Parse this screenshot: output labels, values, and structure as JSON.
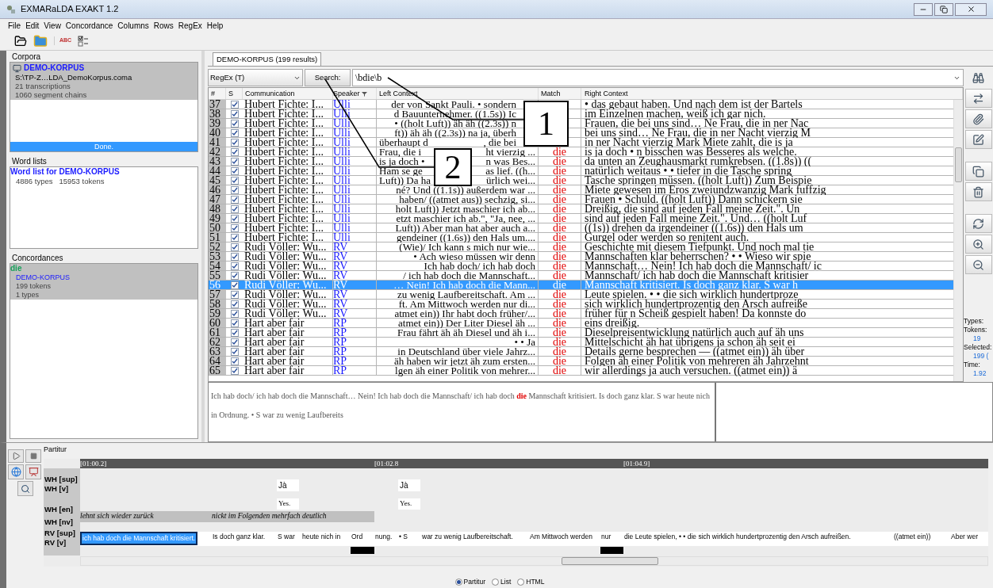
{
  "window": {
    "title": "EXMARaLDA EXAKT 1.2"
  },
  "menu": [
    "File",
    "Edit",
    "View",
    "Concordance",
    "Columns",
    "Rows",
    "RegEx",
    "Help"
  ],
  "toolbar": {
    "spell_label": "ABC"
  },
  "corpora": {
    "title": "Corpora",
    "items": [
      {
        "name": "DEMO-KORPUS",
        "path": "S:\\TP-Z…LDA_DemoKorpus.coma",
        "transcriptions": "21 transcriptions",
        "chains": "1060 segment chains",
        "selected": true
      }
    ],
    "progress": {
      "label": "Done.",
      "level": 1
    }
  },
  "word_lists": {
    "title": "Word lists",
    "items": [
      {
        "name": "Word list for DEMO-KORPUS",
        "types": "4886 types",
        "tokens": "15953 tokens"
      }
    ]
  },
  "concordances": {
    "title": "Concordances",
    "items": [
      {
        "query": "die",
        "corpus": "DEMO-KORPUS",
        "tokens": "199 tokens",
        "types": "1 types",
        "selected": true
      }
    ]
  },
  "tab": {
    "label": "DEMO-KORPUS (199 results)",
    "selected": true
  },
  "search": {
    "mode": "RegEx (T)",
    "button": "Search:",
    "value": "\\bdie\\b"
  },
  "table": {
    "columns": [
      "#",
      "S",
      "Communication",
      "Speaker",
      "Left Context",
      "Match",
      "Right Context"
    ],
    "rows": [
      {
        "n": "37",
        "checked": true,
        "communication": "Hubert Fichte: I...",
        "speaker": "Ulli",
        "left": "der von Sankt Pauli. • sondern",
        "right": "• das gebaut haben. Und nach dem ist der Bartels",
        "selected": false
      },
      {
        "n": "38",
        "checked": true,
        "communication": "Hubert Fichte: I...",
        "speaker": "Ulli",
        "left": "d Bauunternehmer. ((1.5s)) Ic",
        "right": "im Einzelnen machen, weiß ich gar nich.",
        "selected": false
      },
      {
        "n": "39",
        "checked": true,
        "communication": "Hubert Fichte: I...",
        "speaker": "Ulli",
        "left": "• ((holt Luft)) äh äh ((2.3s)) n",
        "right": "Frauen, die bei uns sind… Ne Frau, die in ner Nac",
        "selected": false
      },
      {
        "n": "40",
        "checked": true,
        "communication": "Hubert Fichte: I...",
        "speaker": "Ulli",
        "left": "ft)) äh äh ((2.3s)) na ja, überh",
        "right": "bei uns sind… Ne Frau, die in ner Nacht vierzig M",
        "selected": false
      },
      {
        "n": "41",
        "checked": true,
        "communication": "Hubert Fichte: I...",
        "speaker": "Ulli",
        "left": "überhaupt d",
        "left_tail": ", die bei",
        "right": "in ner Nacht vierzig Mark Miete zahlt, die is ja",
        "selected": false
      },
      {
        "n": "42",
        "checked": true,
        "communication": "Hubert Fichte: I...",
        "speaker": "Ulli",
        "left": "Frau, die i",
        "left_tail": "ht vierzig ...",
        "match": "die",
        "right": "is ja doch • n bisschen was Besseres als welche.",
        "selected": false
      },
      {
        "n": "43",
        "checked": true,
        "communication": "Hubert Fichte: I...",
        "speaker": "Ulli",
        "left": "is ja doch •",
        "left_tail": "n was Bes...",
        "match": "die",
        "right": "da unten an Zeughausmarkt rumkrebsen. ((1.8s)) ((",
        "selected": false
      },
      {
        "n": "44",
        "checked": true,
        "communication": "Hubert Fichte: I...",
        "speaker": "Ulli",
        "left": "Ham se ge",
        "left_tail": "as lief. ((h...",
        "match": "die",
        "right": "natürlich weitaus • • tiefer in die Tasche spring",
        "selected": false
      },
      {
        "n": "45",
        "checked": true,
        "communication": "Hubert Fichte: I...",
        "speaker": "Ulli",
        "left": "Luft)) Da ha",
        "left_tail": "ürlich wei...",
        "match": "die",
        "right": "Tasche springen müssen. ((holt Luft)) Zum Beispie",
        "selected": false
      },
      {
        "n": "46",
        "checked": true,
        "communication": "Hubert Fichte: I...",
        "speaker": "Ulli",
        "left": "né? Und ((1.1s)) außerdem war ...",
        "match": "die",
        "right": "Miete gewesen im Eros zweiundzwanzig Mark fuffzig",
        "selected": false
      },
      {
        "n": "47",
        "checked": true,
        "communication": "Hubert Fichte: I...",
        "speaker": "Ulli",
        "left": "haben/ ((atmet aus)) sechzig, si...",
        "match": "die",
        "right": "Frauen • Schuld. ((holt Luft)) Dann schickern sie",
        "selected": false
      },
      {
        "n": "48",
        "checked": true,
        "communication": "Hubert Fichte: I...",
        "speaker": "Ulli",
        "left": "holt Luft)) Jetzt maschier ich ab...",
        "match": "die",
        "right": "Dreißig, die sind auf jeden Fall meine Zeit.\". Un",
        "selected": false
      },
      {
        "n": "49",
        "checked": true,
        "communication": "Hubert Fichte: I...",
        "speaker": "Ulli",
        "left": "etzt maschier ich ab.\", \"Ja, nee, ...",
        "match": "die",
        "right": "sind auf jeden Fall meine Zeit.\". Und… ((holt Luf",
        "selected": false
      },
      {
        "n": "50",
        "checked": true,
        "communication": "Hubert Fichte: I...",
        "speaker": "Ulli",
        "left": "Luft)) Aber man hat aber auch a...",
        "match": "die",
        "right": "((1s)) drehen da irgendeiner ((1.6s)) den Hals um",
        "selected": false
      },
      {
        "n": "51",
        "checked": true,
        "communication": "Hubert Fichte: I...",
        "speaker": "Ulli",
        "left": "gendeiner ((1.6s)) den Hals um....",
        "match": "die",
        "right": "Gurgel oder werden so renitent auch.",
        "selected": false
      },
      {
        "n": "52",
        "checked": true,
        "communication": "Rudi Völler: Wu...",
        "speaker": "RV",
        "left": "(Wie)/ Ich kann s mich nur wie...",
        "match": "die",
        "right": "Geschichte mit diesem Tiefpunkt. Und noch mal tie",
        "selected": false
      },
      {
        "n": "53",
        "checked": true,
        "communication": "Rudi Völler: Wu...",
        "speaker": "RV",
        "left": "• Ach wieso müssen wir denn",
        "match": "die",
        "right": "Mannschaften klar beherrschen? • • Wieso wir spie",
        "selected": false
      },
      {
        "n": "54",
        "checked": true,
        "communication": "Rudi Völler: Wu...",
        "speaker": "RV",
        "left": "Ich hab doch/ ich hab doch",
        "match": "die",
        "right": "Mannschaft… Nein! Ich hab doch die Mannschaft/ ic",
        "selected": false
      },
      {
        "n": "55",
        "checked": true,
        "communication": "Rudi Völler: Wu...",
        "speaker": "RV",
        "left": "/ ich hab doch die Mannschaft...",
        "match": "die",
        "right": "Mannschaft/ ich hab doch die Mannschaft kritisier",
        "selected": false
      },
      {
        "n": "56",
        "checked": true,
        "communication": "Rudi Völler: Wu...",
        "speaker": "RV",
        "left": "… Nein! Ich hab doch die Mann...",
        "match": "die",
        "right": "Mannschaft kritisiert. Is doch ganz klar. S war h",
        "selected": true
      },
      {
        "n": "57",
        "checked": true,
        "communication": "Rudi Völler: Wu...",
        "speaker": "RV",
        "left": "zu wenig Laufbereitschaft. Am ...",
        "match": "die",
        "right": "Leute spielen. • • die sich wirklich hundertproze",
        "selected": false
      },
      {
        "n": "58",
        "checked": true,
        "communication": "Rudi Völler: Wu...",
        "speaker": "RV",
        "left": "ft. Am Mittwoch werden nur di...",
        "match": "die",
        "right": "sich wirklich hundertprozentig den Arsch aufreiße",
        "selected": false
      },
      {
        "n": "59",
        "checked": true,
        "communication": "Rudi Völler: Wu...",
        "speaker": "RV",
        "left": "atmet ein)) Ihr habt doch früher/...",
        "match": "die",
        "right": "früher für n Scheiß gespielt haben! Da konnste do",
        "selected": false
      },
      {
        "n": "60",
        "checked": true,
        "communication": "Hart aber fair",
        "speaker": "RP",
        "left": "atmet ein)) Der Liter Diesel äh ...",
        "match": "die",
        "right": "eins dreißig.",
        "selected": false
      },
      {
        "n": "61",
        "checked": true,
        "communication": "Hart aber fair",
        "speaker": "RP",
        "left": "Frau fährt äh äh Diesel und äh i...",
        "match": "die",
        "right": "Dieselpreisentwicklung natürlich auch auf äh uns",
        "selected": false
      },
      {
        "n": "62",
        "checked": true,
        "communication": "Hart aber fair",
        "speaker": "RP",
        "left": "• • Ja",
        "match": "die",
        "right": "Mittelschicht äh hat übrigens ja schon äh seit ei",
        "selected": false
      },
      {
        "n": "63",
        "checked": true,
        "communication": "Hart aber fair",
        "speaker": "RP",
        "left": "in Deutschland über viele Jahrz...",
        "match": "die",
        "right": "Details gerne besprechen — ((atmet ein)) äh über",
        "selected": false
      },
      {
        "n": "64",
        "checked": true,
        "communication": "Hart aber fair",
        "speaker": "RP",
        "left": "äh haben wir jetzt äh zum ersten...",
        "match": "die",
        "right": "Folgen äh einer Politik von mehreren äh Jahrzehnt",
        "selected": false
      },
      {
        "n": "65",
        "checked": true,
        "communication": "Hart aber fair",
        "speaker": "RP",
        "left": "lgen äh einer Politik von mehrer...",
        "match": "die",
        "right": "wir allerdings ja auch versuchen. ((atmet ein)) ä",
        "selected": false
      }
    ]
  },
  "callouts": [
    {
      "label": "1"
    },
    {
      "label": "2"
    }
  ],
  "stats": [
    "Types:",
    "Tokens:",
    "19",
    "Selected:",
    "199 (",
    "Time:",
    "1.92"
  ],
  "full_text": "Ich hab doch/ ich hab doch die Mannschaft… Nein! Ich hab doch die Mannschaft/ ich hab doch **die** Mannschaft kritisiert. Is doch ganz klar. S war heute nich in Ordnung. • S war zu wenig Laufbereits",
  "partitur": {
    "title": "Partitur",
    "times": [
      "[01:00.2]",
      "[01:02.8",
      "[01:04.9]"
    ],
    "tiers": [
      {
        "label": "WH [sup]",
        "kind": "plain"
      },
      {
        "label": "WH [v]",
        "kind": "verbal",
        "events": [
          "Jà",
          "Jà"
        ]
      },
      {
        "label": "WH [en]",
        "kind": "translation",
        "events": [
          "Yes.",
          "Yes."
        ]
      },
      {
        "label": "WH [nv]",
        "kind": "nonverbal",
        "events": [
          "lehnt sich wieder zurück",
          "nickt im Folgenden mehrfach deutlich"
        ]
      },
      {
        "label": "RV [sup]",
        "kind": "plain"
      },
      {
        "label": "RV [v]",
        "kind": "main",
        "events": [
          {
            "text": "ich hab doch die Mannschaft kritisiert.",
            "selected": true
          },
          {
            "text": "Is doch ganz klar.",
            "selected": false
          },
          {
            "text": "S war",
            "selected": false
          },
          {
            "text": "heute nich in",
            "selected": false
          },
          {
            "text": "Ord",
            "selected": false
          },
          {
            "text": "nung.",
            "selected": false
          },
          {
            "text": "• S",
            "selected": false
          },
          {
            "text": "war zu wenig Laufbereitschaft.",
            "selected": false
          },
          {
            "text": "Am Mittwoch werden",
            "selected": false
          },
          {
            "text": "nur",
            "selected": false
          },
          {
            "text": "die Leute spielen, • • die sich wirklich hundertprozentig den Arsch aufreißen.",
            "selected": false
          },
          {
            "text": "((atmet ein))",
            "selected": false
          },
          {
            "text": "Aber wer",
            "selected": false
          }
        ]
      }
    ]
  },
  "views": [
    {
      "label": "Partitur",
      "selected": true
    },
    {
      "label": "List",
      "selected": false
    },
    {
      "label": "HTML",
      "selected": false
    }
  ]
}
